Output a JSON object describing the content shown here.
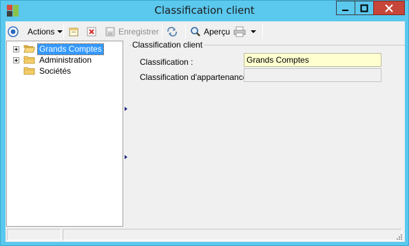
{
  "window": {
    "title": "Classification client"
  },
  "toolbar": {
    "actions_label": "Actions",
    "save_label": "Enregistrer",
    "preview_label": "Aperçu"
  },
  "tree": {
    "items": [
      {
        "label": "Grands Comptes",
        "selected": true,
        "expandable": true
      },
      {
        "label": "Administration",
        "selected": false,
        "expandable": true
      },
      {
        "label": "Sociétés",
        "selected": false,
        "expandable": false
      }
    ]
  },
  "detail": {
    "group_title": "Classification client",
    "classification_label": "Classification :",
    "classification_value": "Grands Comptes",
    "parent_label": "Classification d'appartenance :",
    "parent_value": ""
  },
  "colors": {
    "titlebar": "#5bc8ee",
    "close_button": "#c7463a",
    "selection": "#3399ff",
    "field_highlight": "#ffffd0"
  },
  "icons": [
    "app-icon",
    "minimize-icon",
    "maximize-icon",
    "close-icon",
    "circle-target-icon",
    "new-record-icon",
    "delete-icon",
    "save-icon",
    "refresh-icon",
    "magnifier-icon",
    "printer-icon",
    "folder-icon",
    "resize-grip-icon"
  ]
}
